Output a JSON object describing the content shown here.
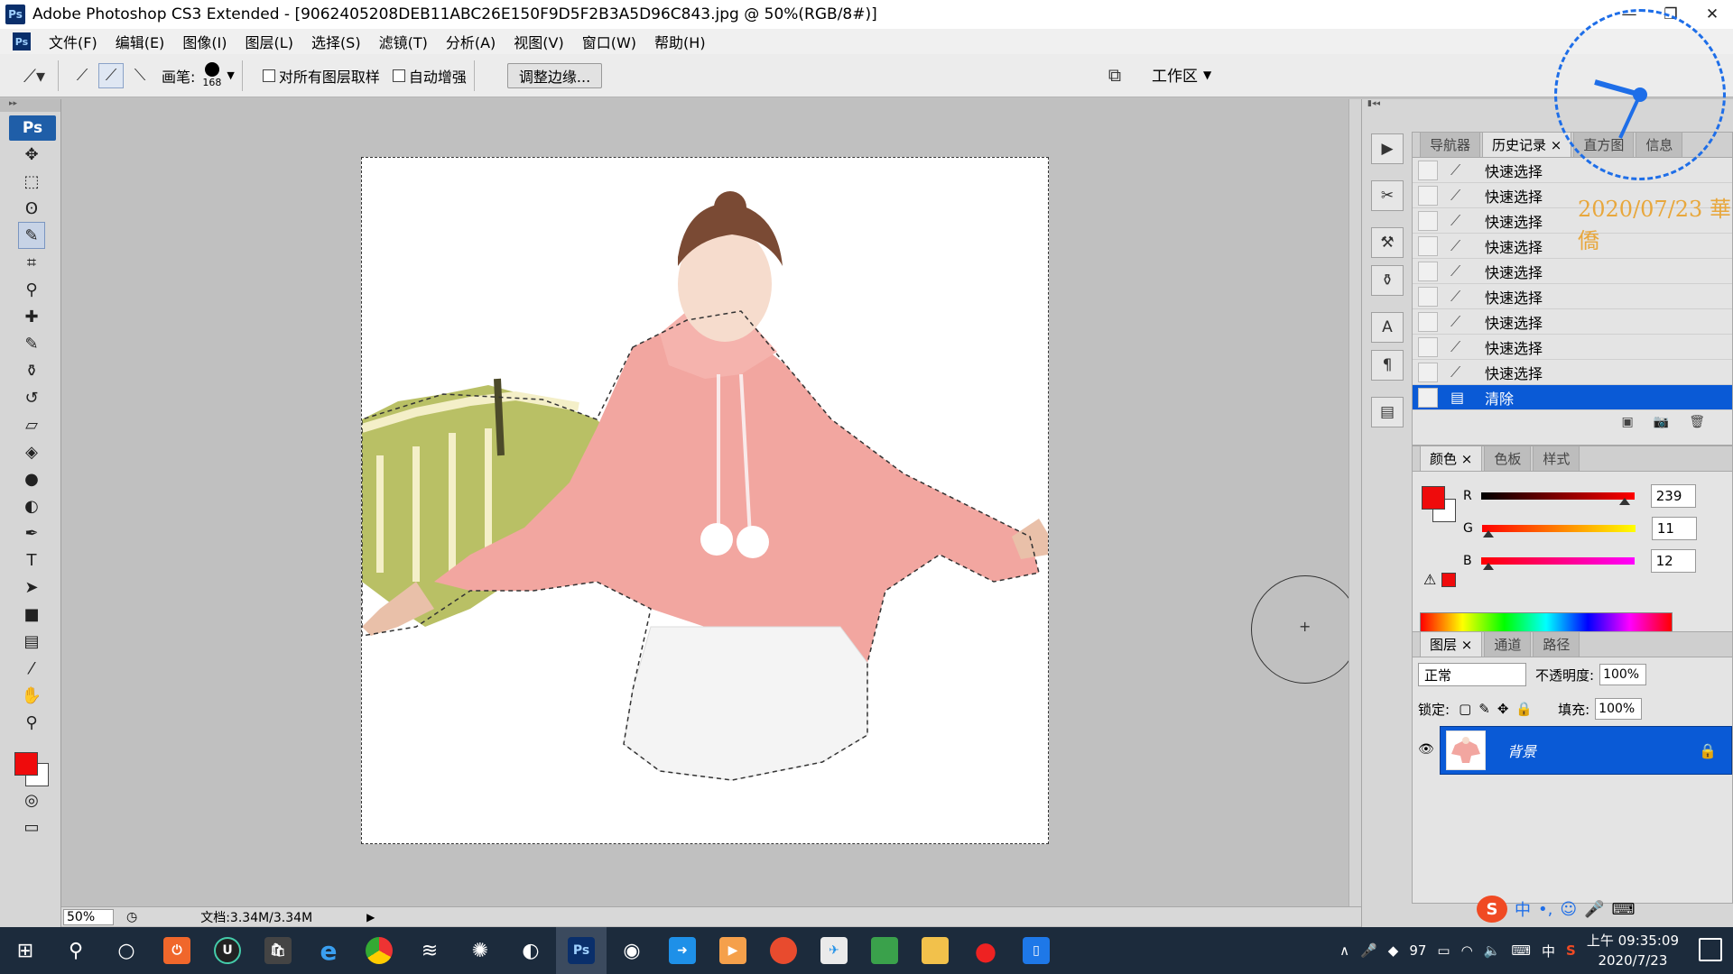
{
  "window": {
    "title": "Adobe Photoshop CS3 Extended - [9062405208DEB11ABC26E150F9D5F2B3A5D96C843.jpg @ 50%(RGB/8#)]",
    "minimize": "—",
    "restore": "❐",
    "close": "✕"
  },
  "menu": [
    "文件(F)",
    "编辑(E)",
    "图像(I)",
    "图层(L)",
    "选择(S)",
    "滤镜(T)",
    "分析(A)",
    "视图(V)",
    "窗口(W)",
    "帮助(H)"
  ],
  "options": {
    "brush_label": "画笔:",
    "brush_size": "168",
    "sample_all_label": "对所有图层取样",
    "auto_enhance_label": "自动增强",
    "refine_edge": "调整边缘...",
    "workspace": "工作区"
  },
  "toolbox": {
    "badge": "Ps",
    "tools": [
      {
        "name": "move-tool",
        "glyph": "✥"
      },
      {
        "name": "marquee-tool",
        "glyph": "⬚"
      },
      {
        "name": "lasso-tool",
        "glyph": "ʘ"
      },
      {
        "name": "quick-selection-tool",
        "glyph": "✎",
        "active": true
      },
      {
        "name": "crop-tool",
        "glyph": "⌗"
      },
      {
        "name": "eyedropper-tool",
        "glyph": "⚲"
      },
      {
        "name": "healing-brush-tool",
        "glyph": "✚"
      },
      {
        "name": "brush-tool",
        "glyph": "✎"
      },
      {
        "name": "clone-stamp-tool",
        "glyph": "⚱"
      },
      {
        "name": "history-brush-tool",
        "glyph": "↺"
      },
      {
        "name": "eraser-tool",
        "glyph": "▱"
      },
      {
        "name": "paint-bucket-tool",
        "glyph": "◈"
      },
      {
        "name": "blur-tool",
        "glyph": "●"
      },
      {
        "name": "dodge-tool",
        "glyph": "◐"
      },
      {
        "name": "pen-tool",
        "glyph": "✒"
      },
      {
        "name": "type-tool",
        "glyph": "T"
      },
      {
        "name": "path-selection-tool",
        "glyph": "➤"
      },
      {
        "name": "shape-tool",
        "glyph": "■"
      },
      {
        "name": "notes-tool",
        "glyph": "▤"
      },
      {
        "name": "measure-eyedropper-tool",
        "glyph": "⁄"
      },
      {
        "name": "hand-tool",
        "glyph": "✋"
      },
      {
        "name": "zoom-tool",
        "glyph": "⚲"
      }
    ],
    "foreground_color": "#ef0b0c",
    "background_color": "#ffffff"
  },
  "status": {
    "zoom": "50%",
    "doc_size": "文档:3.34M/3.34M"
  },
  "history": {
    "tabs": [
      "导航器",
      "历史记录",
      "直方图",
      "信息"
    ],
    "active_tab": 1,
    "items": [
      {
        "label": "快速选择",
        "icon": "quick-selection"
      },
      {
        "label": "快速选择",
        "icon": "quick-selection"
      },
      {
        "label": "快速选择",
        "icon": "quick-selection"
      },
      {
        "label": "快速选择",
        "icon": "quick-selection"
      },
      {
        "label": "快速选择",
        "icon": "quick-selection"
      },
      {
        "label": "快速选择",
        "icon": "quick-selection"
      },
      {
        "label": "快速选择",
        "icon": "quick-selection"
      },
      {
        "label": "快速选择",
        "icon": "quick-selection"
      },
      {
        "label": "快速选择",
        "icon": "quick-selection"
      },
      {
        "label": "清除",
        "icon": "clear",
        "selected": true
      }
    ]
  },
  "color_panel": {
    "tabs": [
      "颜色",
      "色板",
      "样式"
    ],
    "r_label": "R",
    "g_label": "G",
    "b_label": "B",
    "r": "239",
    "g": "11",
    "b": "12",
    "r_fraction": 0.937,
    "g_fraction": 0.043,
    "b_fraction": 0.047
  },
  "layers_panel": {
    "tabs": [
      "图层",
      "通道",
      "路径"
    ],
    "blend_mode": "正常",
    "opacity_label": "不透明度:",
    "opacity": "100%",
    "lock_label": "锁定:",
    "fill_label": "填充:",
    "fill": "100%",
    "layer_name": "背景"
  },
  "clock_widget": {
    "date": "2020/07/23 華僑"
  },
  "taskbar": {
    "time": "上午 09:35:09",
    "date": "2020/7/23",
    "ime": "中",
    "battery": "97"
  },
  "ime_bar": [
    "中",
    "•,",
    "☺",
    "🎤",
    "⌨"
  ]
}
